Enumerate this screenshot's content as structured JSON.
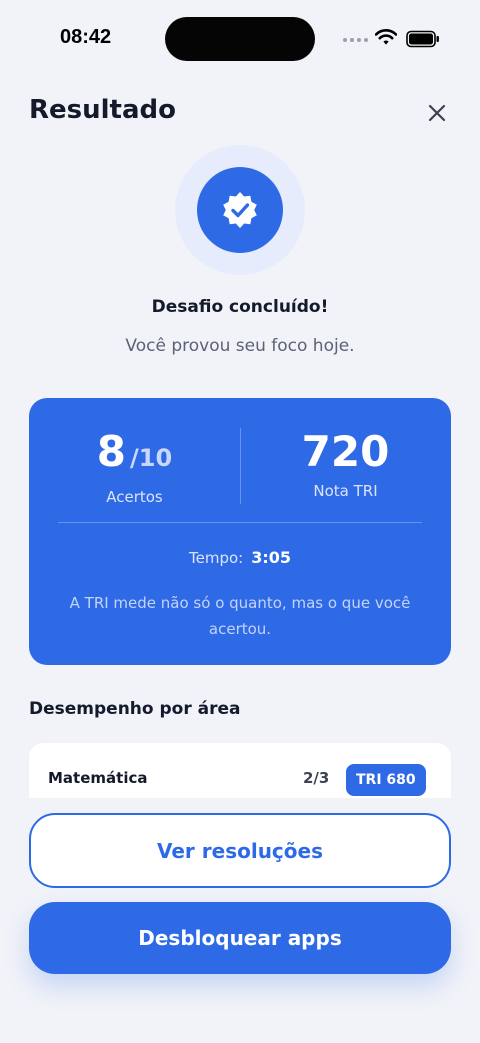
{
  "status_bar": {
    "time": "08:42",
    "signal_icon": "cellular-dots-icon",
    "wifi_icon": "wifi-icon",
    "battery_icon": "battery-icon"
  },
  "header": {
    "title": "Resultado",
    "close_icon": "close-icon"
  },
  "completion": {
    "badge_icon": "verified-check-badge-icon",
    "title": "Desafio concluído!",
    "subtitle": "Você provou seu foco hoje."
  },
  "score_card": {
    "correct": "8",
    "total": "/10",
    "correct_label": "Acertos",
    "tri_score": "720",
    "tri_label": "Nota TRI",
    "time_label": "Tempo:",
    "time_value": "3:05",
    "note": "A TRI mede não só o quanto, mas o que você acertou."
  },
  "performance": {
    "title": "Desempenho por área",
    "areas": [
      {
        "name": "Matemática",
        "score": "2/3",
        "tri": "TRI 680"
      }
    ]
  },
  "actions": {
    "secondary_label": "Ver resoluções",
    "primary_label": "Desbloquear apps"
  },
  "colors": {
    "accent": "#2f6ae6",
    "background": "#f1f3f8",
    "text": "#141a2b"
  }
}
